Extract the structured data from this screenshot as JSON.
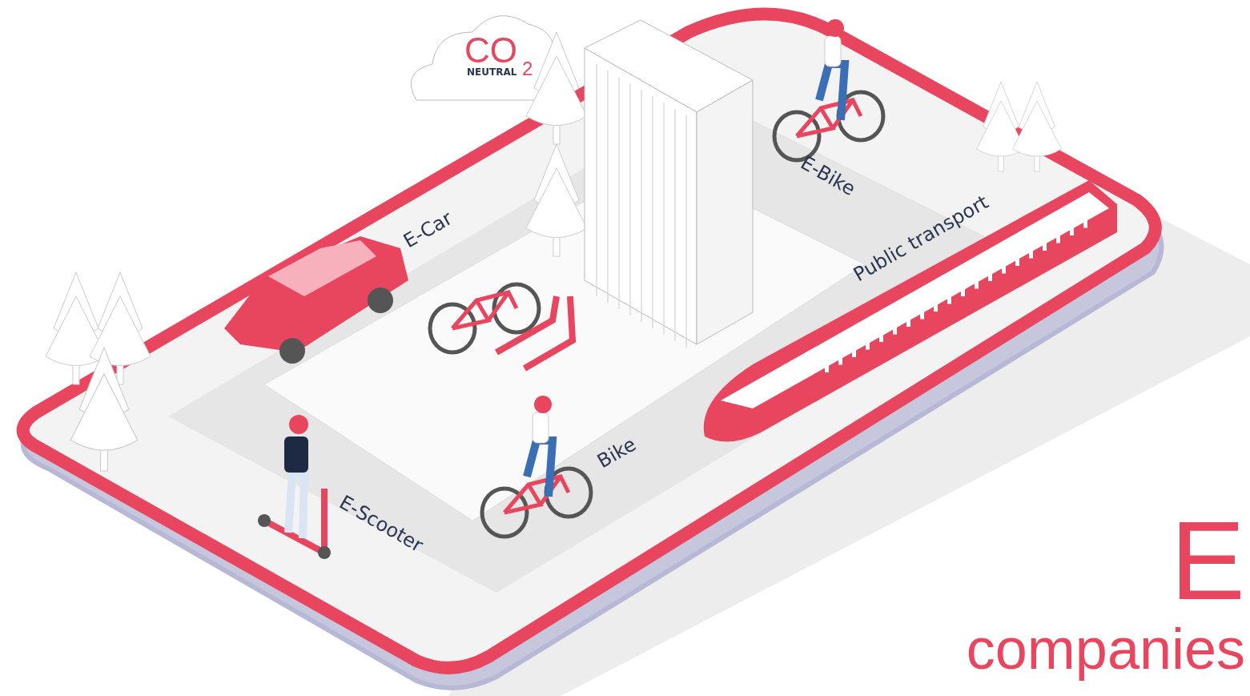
{
  "illustration": {
    "badge": {
      "main": "CO",
      "subscript": "2",
      "caption": "NEUTRAL"
    },
    "labels": [
      {
        "text": "E-Car"
      },
      {
        "text": "E-Bike"
      },
      {
        "text": "Public transport"
      },
      {
        "text": "Bike"
      },
      {
        "text": "E-Scooter"
      }
    ]
  },
  "headline": {
    "line_1": "E",
    "line_2": "companies"
  }
}
